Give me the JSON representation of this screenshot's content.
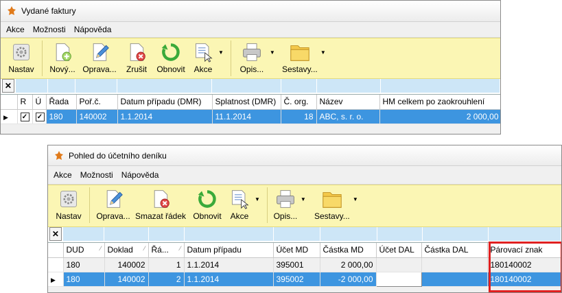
{
  "window1": {
    "title": "Vydané faktury",
    "menu": [
      "Akce",
      "Možnosti",
      "Nápověda"
    ],
    "toolbar": [
      {
        "label": "Nastav",
        "icon": "gear-icon"
      },
      {
        "label": "Nový...",
        "icon": "new-document-icon"
      },
      {
        "label": "Oprava...",
        "icon": "edit-pencil-icon"
      },
      {
        "label": "Zrušit",
        "icon": "delete-document-icon"
      },
      {
        "label": "Obnovit",
        "icon": "refresh-icon"
      },
      {
        "label": "Akce",
        "icon": "document-cursor-icon"
      },
      {
        "label": "Opis...",
        "icon": "printer-icon"
      },
      {
        "label": "Sestavy...",
        "icon": "folder-icon"
      }
    ],
    "columns": [
      "R",
      "Ú",
      "Řada",
      "Poř.č.",
      "Datum případu (DMR)",
      "Splatnost (DMR)",
      "Č. org.",
      "Název",
      "HM celkem po zaokrouhlení"
    ],
    "rows": [
      {
        "r": true,
        "u": true,
        "rada": "180",
        "porc": "140002",
        "datum": "1.1.2014",
        "splatnost": "11.1.2014",
        "corg": "18",
        "nazev": "ABC, s. r. o.",
        "hm": "2 000,00"
      }
    ]
  },
  "window2": {
    "title": "Pohled do účetního deníku",
    "menu": [
      "Akce",
      "Možnosti",
      "Nápověda"
    ],
    "toolbar": [
      {
        "label": "Nastav",
        "icon": "gear-icon"
      },
      {
        "label": "Oprava...",
        "icon": "edit-pencil-icon"
      },
      {
        "label": "Smazat řádek",
        "icon": "delete-document-icon"
      },
      {
        "label": "Obnovit",
        "icon": "refresh-icon"
      },
      {
        "label": "Akce",
        "icon": "document-cursor-icon"
      },
      {
        "label": "Opis...",
        "icon": "printer-icon"
      },
      {
        "label": "Sestavy...",
        "icon": "folder-icon"
      }
    ],
    "columns": [
      "DUD",
      "Doklad",
      "Řá...",
      "Datum případu",
      "Účet MD",
      "Částka MD",
      "Účet DAL",
      "Částka DAL",
      "Párovací znak"
    ],
    "rows": [
      {
        "dud": "180",
        "doklad": "140002",
        "radek": "1",
        "datum": "1.1.2014",
        "ucet_md": "395001",
        "castka_md": "2 000,00",
        "ucet_dal": "",
        "castka_dal": "",
        "parovaci": "180140002"
      },
      {
        "dud": "180",
        "doklad": "140002",
        "radek": "2",
        "datum": "1.1.2014",
        "ucet_md": "395002",
        "castka_md": "-2 000,00",
        "ucet_dal": "",
        "castka_dal": "",
        "parovaci": "180140002"
      }
    ]
  },
  "colors": {
    "toolbar_bg": "#fbf6b4",
    "selection": "#3d95e0",
    "highlight_box": "#e02020",
    "filter_cell": "#cde6f7"
  }
}
